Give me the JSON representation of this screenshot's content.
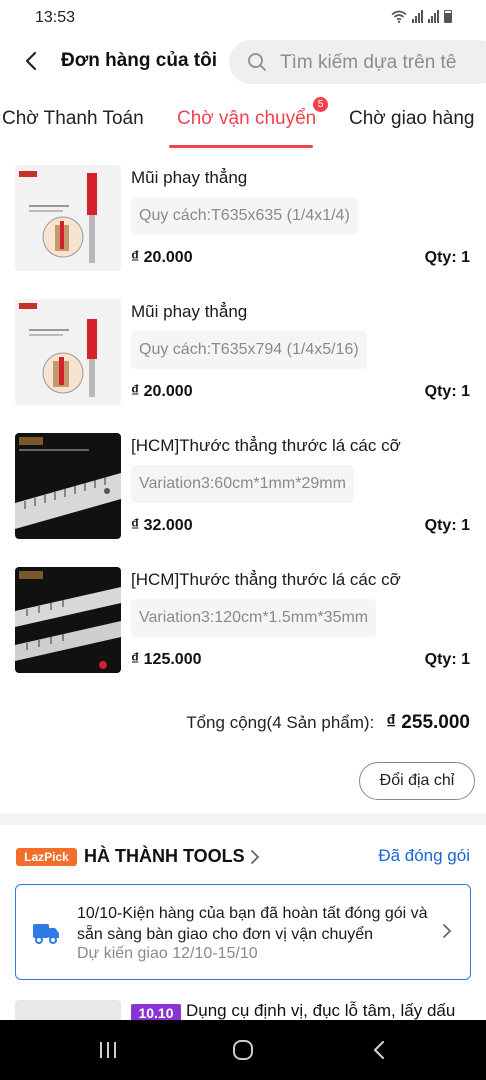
{
  "status_bar": {
    "time": "13:53"
  },
  "header": {
    "title": "Đơn hàng của tôi",
    "search_placeholder": "Tìm kiếm dựa trên tê"
  },
  "tabs": [
    {
      "label": "Chờ Thanh Toán",
      "active": false
    },
    {
      "label": "Chờ vận chuyển",
      "active": true,
      "badge": "5"
    },
    {
      "label": "Chờ giao hàng",
      "active": false
    }
  ],
  "products": [
    {
      "name": "Mũi phay thẳng",
      "variation": "Quy cách:T635x635 (1/4x1/4)",
      "price": "₫ 20.000",
      "qty": "Qty: 1"
    },
    {
      "name": "Mũi phay thẳng",
      "variation": "Quy cách:T635x794 (1/4x5/16)",
      "price": "₫ 20.000",
      "qty": "Qty: 1"
    },
    {
      "name": "[HCM]Thước thẳng thước lá các cỡ",
      "variation": "Variation3:60cm*1mm*29mm",
      "price": "₫ 32.000",
      "qty": "Qty: 1"
    },
    {
      "name": "[HCM]Thước thẳng thước lá các cỡ",
      "variation": "Variation3:120cm*1.5mm*35mm",
      "price": "₫ 125.000",
      "qty": "Qty: 1"
    }
  ],
  "summary": {
    "label": "Tổng cộng(4 Sản phẩm):",
    "total": "₫ 255.000"
  },
  "change_address_label": "Đổi địa chỉ",
  "store": {
    "badge": "LazPick",
    "name": "HÀ THÀNH TOOLS",
    "status": "Đã đóng gói"
  },
  "shipment": {
    "message": "10/10-Kiện hàng của bạn đã hoàn tất đóng gói và sẵn sàng bàn giao cho đơn vị vận chuyển",
    "eta": "Dự kiến giao 12/10-15/10"
  },
  "next_item": {
    "promo": "10.10",
    "name": "Dụng cụ định vị, đục lỗ tâm, lấy dấu"
  },
  "colors": {
    "accent": "#f0424d",
    "link": "#1a66d6",
    "lazpick": "#f36e2b",
    "promo": "#8a34d6"
  }
}
